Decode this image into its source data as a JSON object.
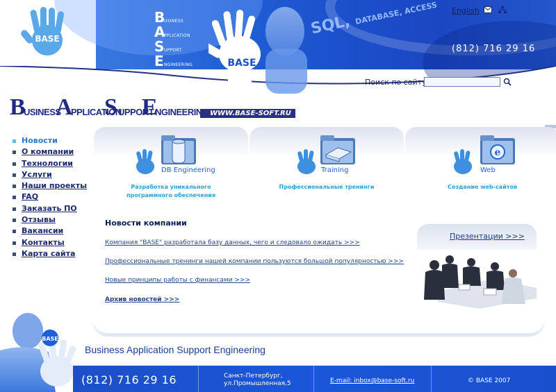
{
  "header": {
    "acronym": [
      {
        "letter": "B",
        "rest": "USINESS"
      },
      {
        "letter": "A",
        "rest": "PPLICATION"
      },
      {
        "letter": "S",
        "rest": "UPPORT"
      },
      {
        "letter": "E",
        "rest": "NGINEERING"
      }
    ],
    "hand_logo_text": "BASE",
    "photo_hand_text": "BASE",
    "sql_text": "SQL, ",
    "sql_small": "DATABASE, ACCESS",
    "lang_link": "English",
    "phone": "(812) 716 29 16",
    "search_label": "Поиск по сайту",
    "search_value": ""
  },
  "banner": {
    "big_letters": [
      "B",
      "A",
      "S",
      "E"
    ],
    "words": [
      "USINESS",
      "PPLICATION",
      "UPPORT",
      "NGINEERING"
    ],
    "url": "WWW.BASE-SOFT.RU"
  },
  "nav": {
    "items": [
      {
        "label": "Новости",
        "active": true
      },
      {
        "label": "О компании"
      },
      {
        "label": "Технологии"
      },
      {
        "label": "Услуги"
      },
      {
        "label": "Наши проекты"
      },
      {
        "label": "FAQ"
      },
      {
        "label": "Заказать ПО"
      },
      {
        "label": "Отзывы"
      },
      {
        "label": "Вакансии"
      },
      {
        "label": "Контакты"
      },
      {
        "label": "Карта сайта"
      }
    ]
  },
  "services": [
    {
      "name": "DB Engineering",
      "desc_line1": "Разработка уникального",
      "desc_line2": "программного обеспечения",
      "icon": "database-folder-icon"
    },
    {
      "name": "Training",
      "desc_line1": "Профессиональные тренинги",
      "desc_line2": "",
      "icon": "training-folder-icon"
    },
    {
      "name": "Web",
      "desc_line1": "Создание web-сайтов",
      "desc_line2": "",
      "icon": "web-folder-icon"
    }
  ],
  "news": {
    "title": "Новости компании",
    "items": [
      "Компания \"BASE\" разработала базу данных, чего и следовало ожидать >>>",
      "Профессиональные тренинги нашей компании пользуются большой популярностью >>>",
      "Новые принципы работы с финансами >>>"
    ],
    "archive": "Архив новостей >>>"
  },
  "presentations": {
    "link": "Презентации >>>"
  },
  "bottom": {
    "tagline": "Business Application Support Engineering",
    "hand_logo_text": "BASE"
  },
  "footer": {
    "phone": "(812) 716 29 16",
    "city_line1": "Санкт-Петербург,",
    "city_line2": "ул.Промышленная,5",
    "email": "E-mail: inbox@base-soft.ru",
    "copyright": "© BASE 2007"
  },
  "colors": {
    "brand_blue": "#1c4fcc",
    "navy": "#202a82",
    "light_blue": "#24a3d8"
  }
}
